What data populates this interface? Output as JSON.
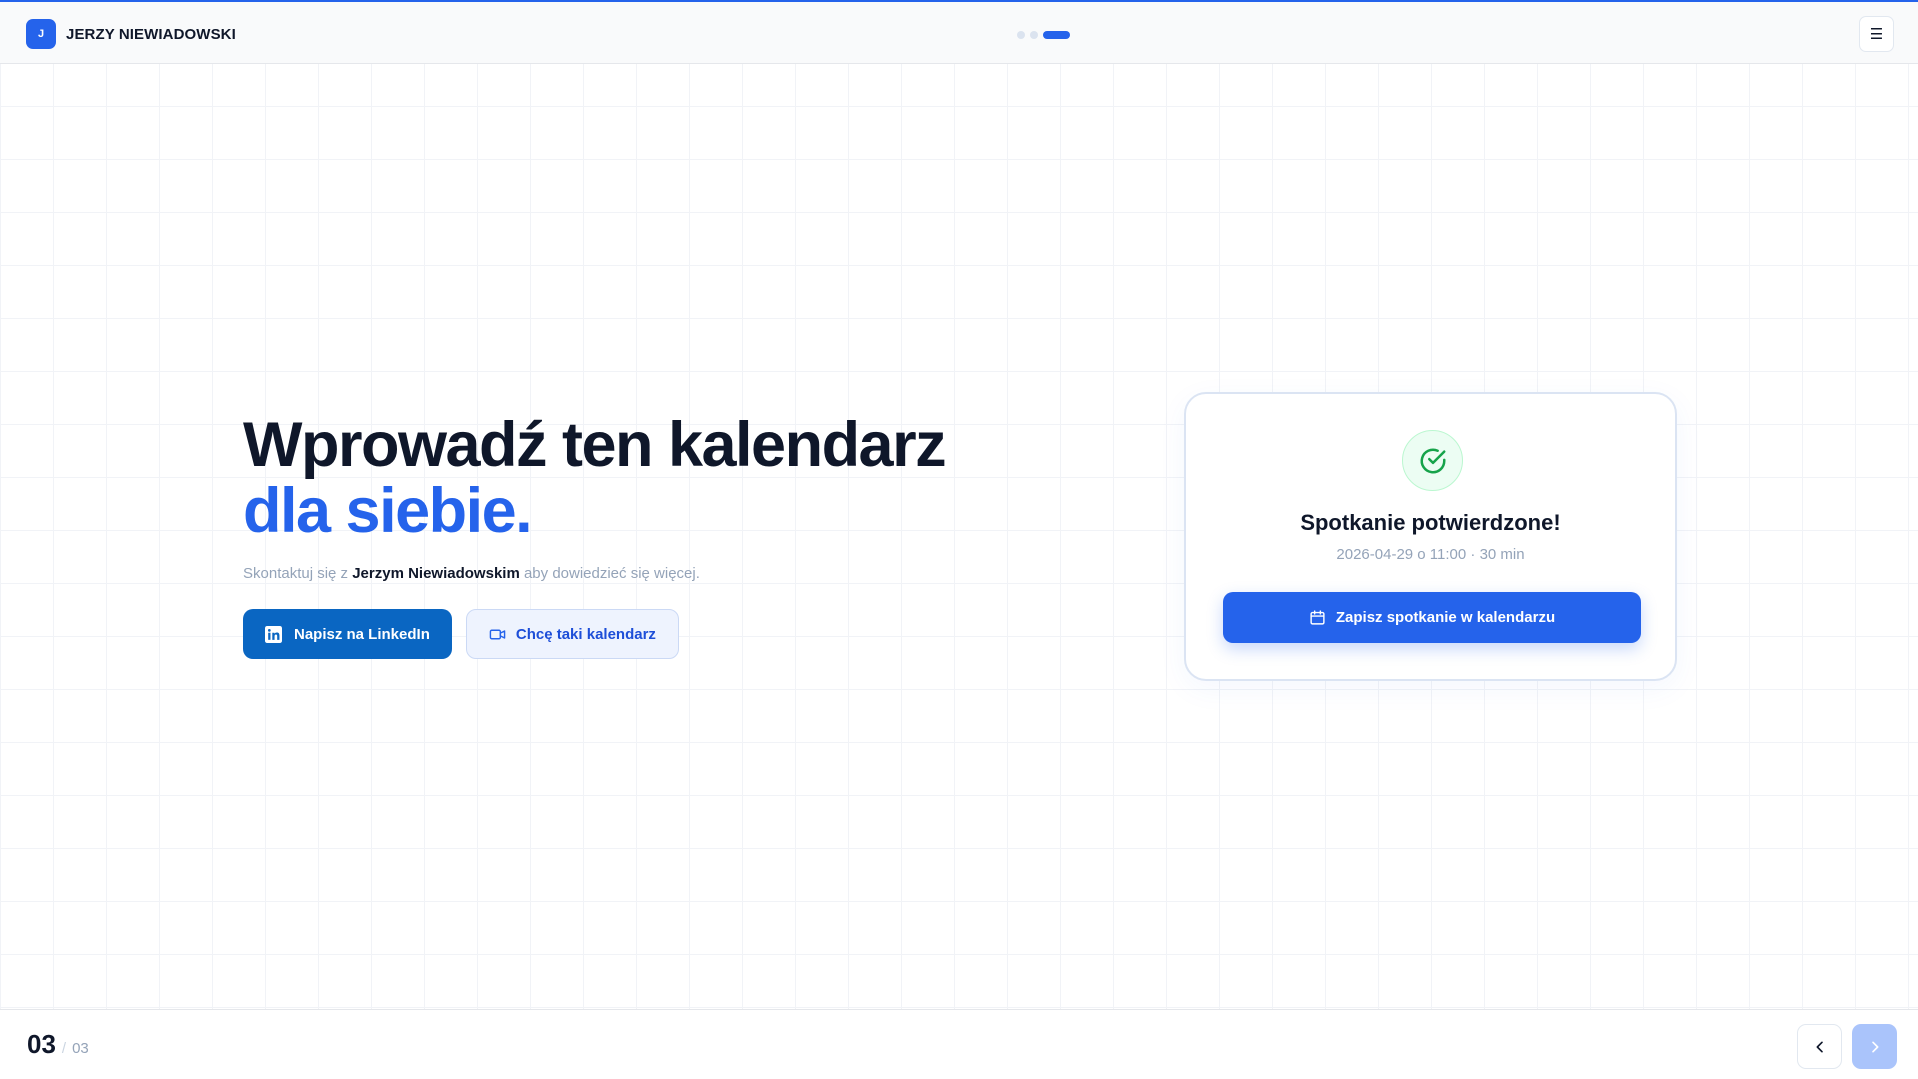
{
  "header": {
    "brand_initial": "J",
    "brand_name": "JERZY NIEWIADOWSKI",
    "progress_total": 3,
    "progress_active": 3,
    "menu_glyph": "☰"
  },
  "hero": {
    "title_line1": "Wprowadź ten kalendarz",
    "title_line2": "dla siebie.",
    "subtitle_before": "Skontaktuj się z ",
    "subtitle_name": "Jerzym Niewiadowskim",
    "subtitle_after": " aby dowiedzieć się więcej.",
    "linkedin_button_label": "Napisz na LinkedIn",
    "calendar_button_label": "Chcę taki kalendarz"
  },
  "confirmation": {
    "title": "Spotkanie potwierdzone!",
    "meta": "2026-04-29 o 11:00 · 30 min",
    "save_button_label": "Zapisz spotkanie w kalendarzu"
  },
  "footer": {
    "page_current": "03",
    "page_separator": "/",
    "page_total": "03"
  },
  "icons": {
    "check": "check-circle-icon",
    "linkedin": "linkedin-icon",
    "video": "video-camera-icon",
    "calendar": "calendar-icon",
    "prev": "chevron-left-icon",
    "next": "chevron-right-icon",
    "menu": "menu-icon"
  },
  "colors": {
    "accent": "#2563eb",
    "linkedin": "#0a66c2",
    "success": "#16a34a"
  }
}
